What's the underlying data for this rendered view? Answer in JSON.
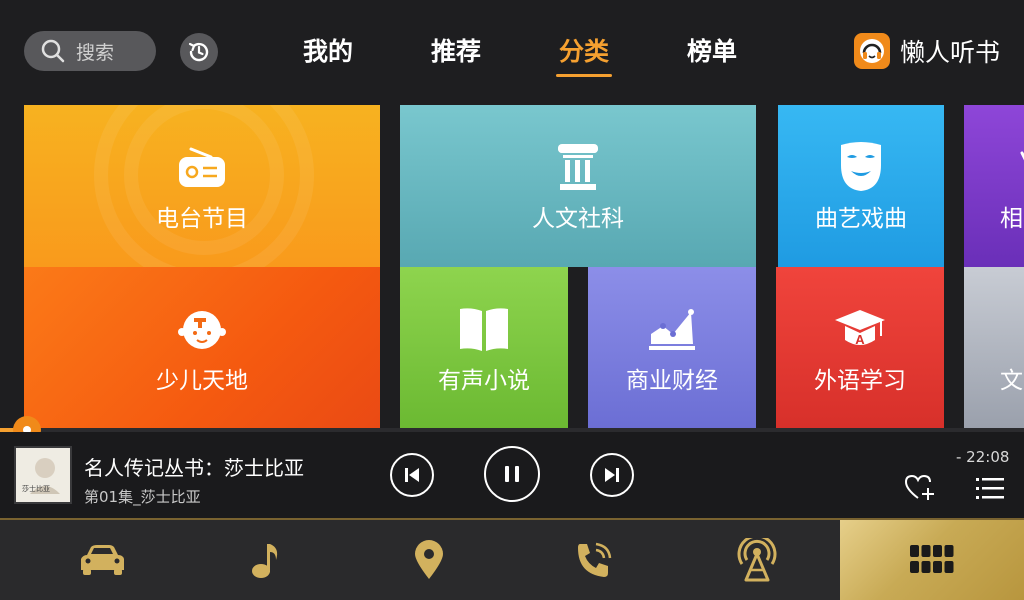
{
  "header": {
    "search_placeholder": "搜索",
    "tabs": [
      {
        "label": "我的"
      },
      {
        "label": "推荐"
      },
      {
        "label": "分类"
      },
      {
        "label": "榜单"
      }
    ],
    "active_tab": "分类",
    "brand_name": "懒人听书"
  },
  "categories": [
    {
      "label": "电台节目",
      "icon": "radio-icon"
    },
    {
      "label": "人文社科",
      "icon": "column-icon"
    },
    {
      "label": "曲艺戏曲",
      "icon": "mask-icon"
    },
    {
      "label": "相",
      "icon": "partial-icon"
    },
    {
      "label": "少儿天地",
      "icon": "kid-face-icon"
    },
    {
      "label": "有声小说",
      "icon": "book-icon"
    },
    {
      "label": "商业财经",
      "icon": "chart-icon"
    },
    {
      "label": "外语学习",
      "icon": "grad-cap-icon"
    },
    {
      "label": "文",
      "icon": "none"
    }
  ],
  "player": {
    "title": "名人传记丛书：莎士比亚",
    "episode": "第01集_莎士比亚",
    "remaining_time": "- 22:08",
    "cover_caption": "莎士比亚",
    "progress_fraction": 0.03
  },
  "bottom_nav": [
    {
      "icon": "car-icon"
    },
    {
      "icon": "music-note-icon"
    },
    {
      "icon": "location-pin-icon"
    },
    {
      "icon": "phone-icon"
    },
    {
      "icon": "broadcast-icon"
    },
    {
      "icon": "apps-grid-icon",
      "active": true
    }
  ],
  "colors": {
    "accent": "#f5a030",
    "gold": "#c8aa55",
    "background": "#1e1e20"
  }
}
